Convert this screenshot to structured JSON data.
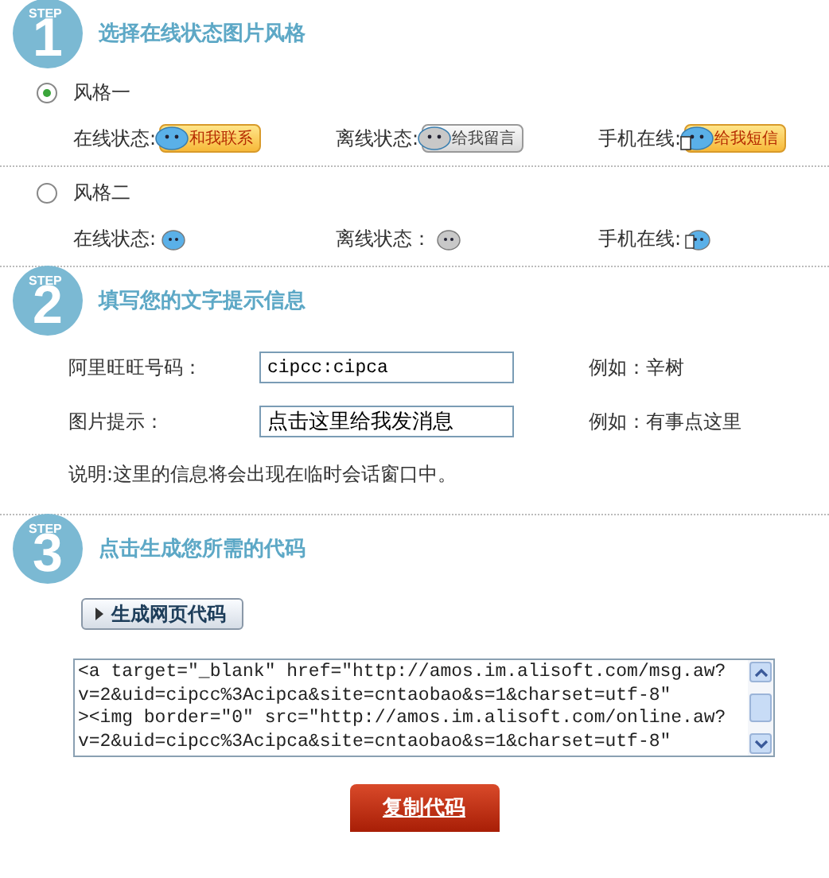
{
  "steps": [
    {
      "badge": "STEP",
      "number": "1",
      "title": "选择在线状态图片风格"
    },
    {
      "badge": "STEP",
      "number": "2",
      "title": "填写您的文字提示信息"
    },
    {
      "badge": "STEP",
      "number": "3",
      "title": "点击生成您所需的代码"
    }
  ],
  "styles": [
    {
      "label": "风格一",
      "selected": true,
      "kind": "large",
      "statuses": [
        {
          "label": "在线状态:",
          "kind": "online",
          "caption": "和我联系"
        },
        {
          "label": "离线状态:",
          "kind": "offline",
          "caption": "给我留言"
        },
        {
          "label": "手机在线:",
          "kind": "mobile",
          "caption": "给我短信"
        }
      ]
    },
    {
      "label": "风格二",
      "selected": false,
      "kind": "small",
      "statuses": [
        {
          "label": "在线状态:",
          "kind": "online"
        },
        {
          "label": "离线状态：",
          "kind": "offline"
        },
        {
          "label": "手机在线:",
          "kind": "mobile"
        }
      ]
    }
  ],
  "fields": [
    {
      "label": "阿里旺旺号码：",
      "value": "cipcc:cipca",
      "example": "例如：辛树",
      "kind": "mono"
    },
    {
      "label": "图片提示：",
      "value": "点击这里给我发消息",
      "example": "例如：有事点这里",
      "kind": "plain"
    }
  ],
  "note": "说明:这里的信息将会出现在临时会话窗口中。",
  "generate_button": "生成网页代码",
  "code_lines": [
    "<a target=\"_blank\" href=\"http://amos.im.alisoft.com/msg.aw?",
    "v=2&uid=cipcc%3Acipca&site=cntaobao&s=1&charset=utf-8\"",
    "><img border=\"0\" src=\"http://amos.im.alisoft.com/online.aw?",
    "v=2&uid=cipcc%3Acipca&site=cntaobao&s=1&charset=utf-8\""
  ],
  "copy_button": "复制代码"
}
